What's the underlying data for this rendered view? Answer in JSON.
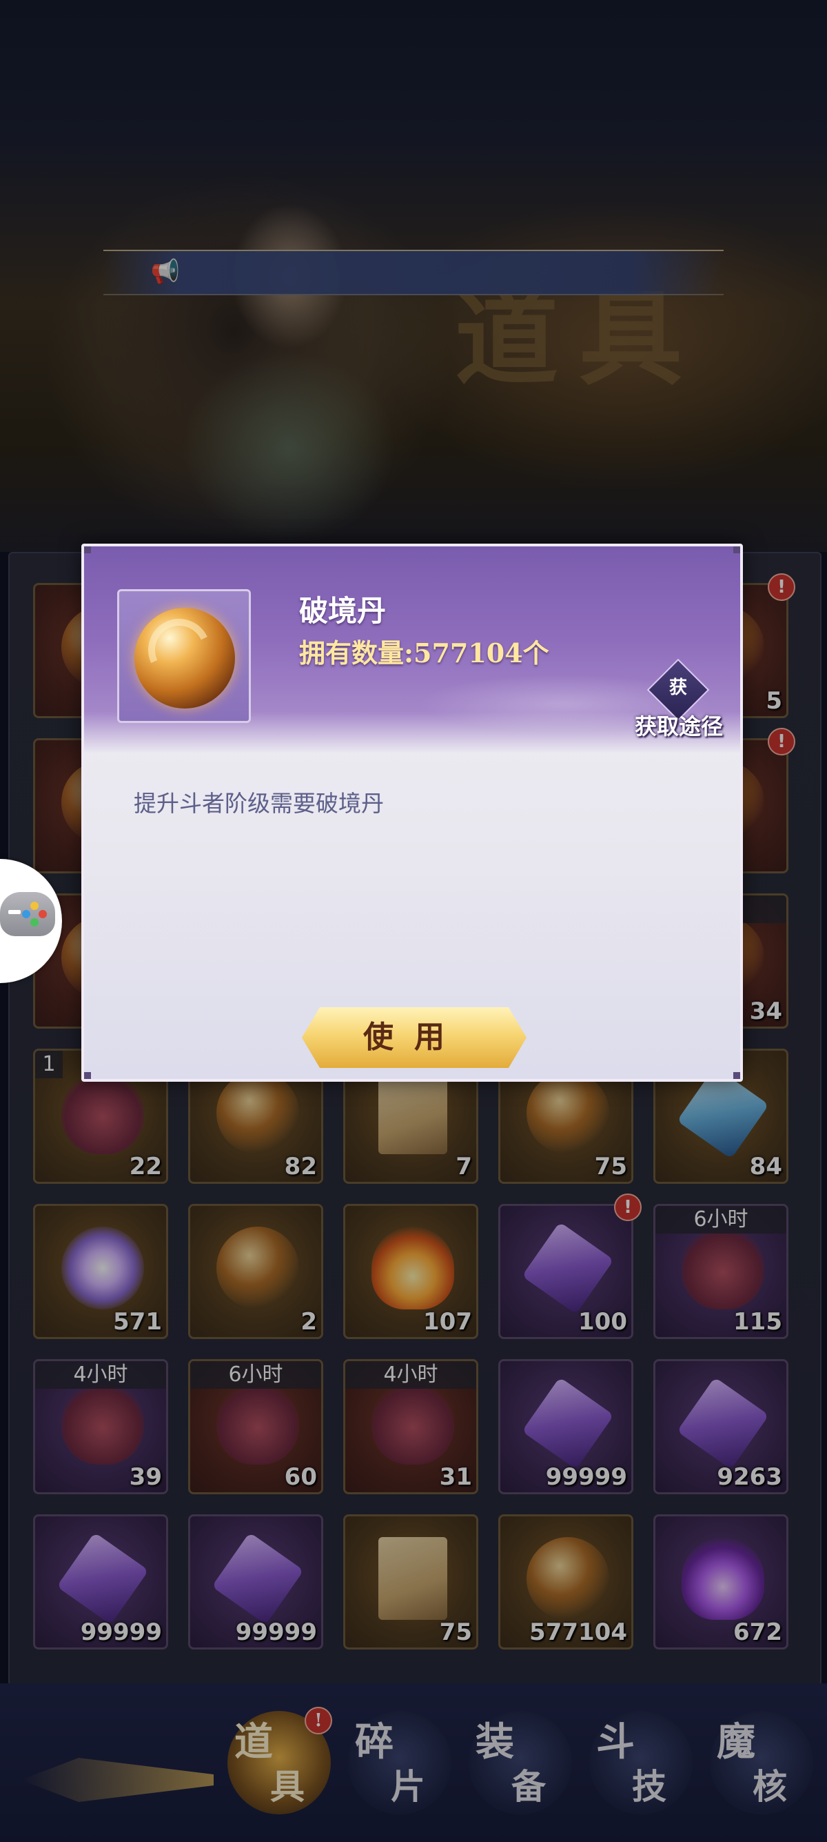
{
  "background": {
    "title": "道具"
  },
  "banner": {
    "icon": "speaker-icon",
    "text": ""
  },
  "dialog": {
    "item_name": "破境丹",
    "owned_text": "拥有数量:577104个",
    "source_button": {
      "badge": "获",
      "label": "获取途径"
    },
    "description": "提升斗者阶级需要破境丹",
    "use_button": "使用"
  },
  "inventory": {
    "visible_cells": [
      {
        "count": "5"
      },
      {
        "count": "34",
        "timer": "时"
      },
      {
        "count": "22",
        "timer": "1"
      },
      {
        "count": "82"
      },
      {
        "count": "7"
      },
      {
        "count": "75"
      },
      {
        "count": "84"
      },
      {
        "count": "571"
      },
      {
        "count": "2"
      },
      {
        "count": "107"
      },
      {
        "count": "100",
        "alert": true
      },
      {
        "count": "115",
        "timer": "6小时"
      },
      {
        "count": "39",
        "timer": "4小时"
      },
      {
        "count": "60",
        "timer": "6小时"
      },
      {
        "count": "31",
        "timer": "4小时"
      },
      {
        "count": "99999"
      },
      {
        "count": "9263"
      },
      {
        "count": "99999"
      },
      {
        "count": "99999"
      },
      {
        "count": "75"
      },
      {
        "count": "577104"
      },
      {
        "count": "672"
      }
    ]
  },
  "bottom_nav": {
    "tabs": [
      {
        "line1": "道",
        "line2": "具",
        "active": true,
        "alert": true
      },
      {
        "line1": "碎",
        "line2": "片"
      },
      {
        "line1": "装",
        "line2": "备"
      },
      {
        "line1": "斗",
        "line2": "技"
      },
      {
        "line1": "魔",
        "line2": "核"
      }
    ]
  },
  "alert_mark": "!",
  "side_button": {
    "icon": "gamepad-icon"
  }
}
